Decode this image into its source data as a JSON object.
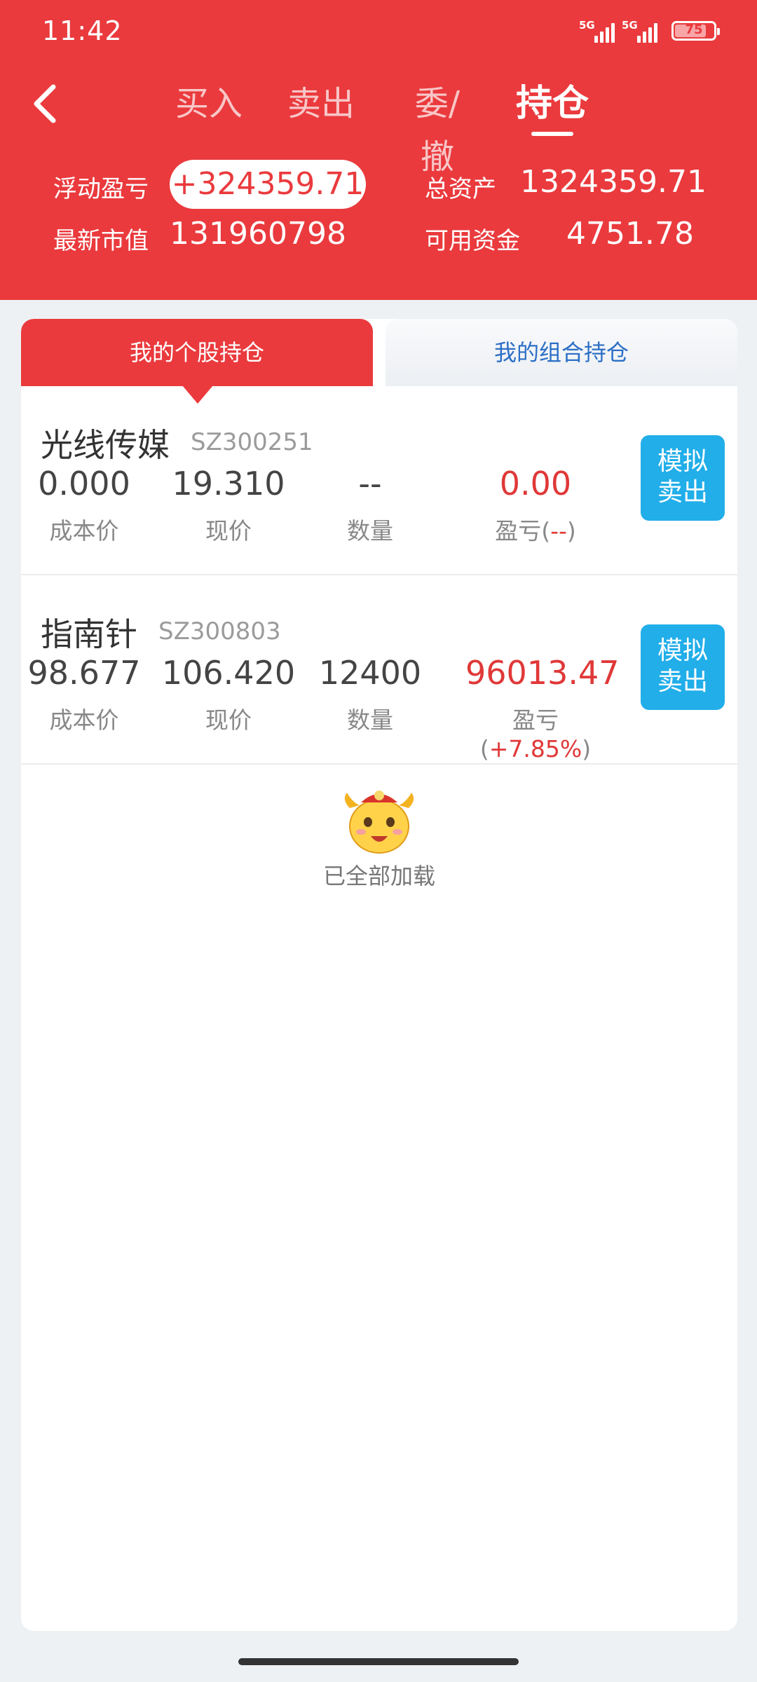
{
  "status_bar": {
    "time": "11:42",
    "sim1": "5G",
    "sim2": "5G",
    "battery": "75"
  },
  "tabs": [
    {
      "label": "买入"
    },
    {
      "label": "卖出"
    },
    {
      "label": "委/撤"
    },
    {
      "label": "持仓"
    }
  ],
  "active_tab": "持仓",
  "summary": {
    "floating_pl_label": "浮动盈亏",
    "floating_pl_value": "+324359.71",
    "total_assets_label": "总资产",
    "total_assets_value": "1324359.71",
    "market_value_label": "最新市值",
    "market_value_value": "131960798",
    "available_funds_label": "可用资金",
    "available_funds_value": "4751.78"
  },
  "segments": {
    "left": "我的个股持仓",
    "right": "我的组合持仓"
  },
  "positions": [
    {
      "name": "光线传媒",
      "code": "SZ300251",
      "cost": "0.000",
      "price": "19.310",
      "qty": "--",
      "pl": "0.00",
      "pct": "--",
      "button": [
        "模拟",
        "卖出"
      ]
    },
    {
      "name": "指南针",
      "code": "SZ300803",
      "cost": "98.677",
      "price": "106.420",
      "qty": "12400",
      "pl": "96013.47",
      "pct": "+7.85%",
      "button": [
        "模拟",
        "卖出"
      ]
    }
  ],
  "labels": {
    "cost": "成本价",
    "price": "现价",
    "qty": "数量",
    "pl_prefix": "盈亏(",
    "pl_suffix": ")"
  },
  "footer": {
    "loaded_text": "已全部加载"
  },
  "colors": {
    "brand_red": "#ea3a3d",
    "button_blue": "#21aee9",
    "link_blue": "#2c6fc6",
    "loss_red": "#e03838"
  },
  "icons": {
    "back": "chevron-left-icon",
    "mascot": "ox-mascot-icon"
  }
}
